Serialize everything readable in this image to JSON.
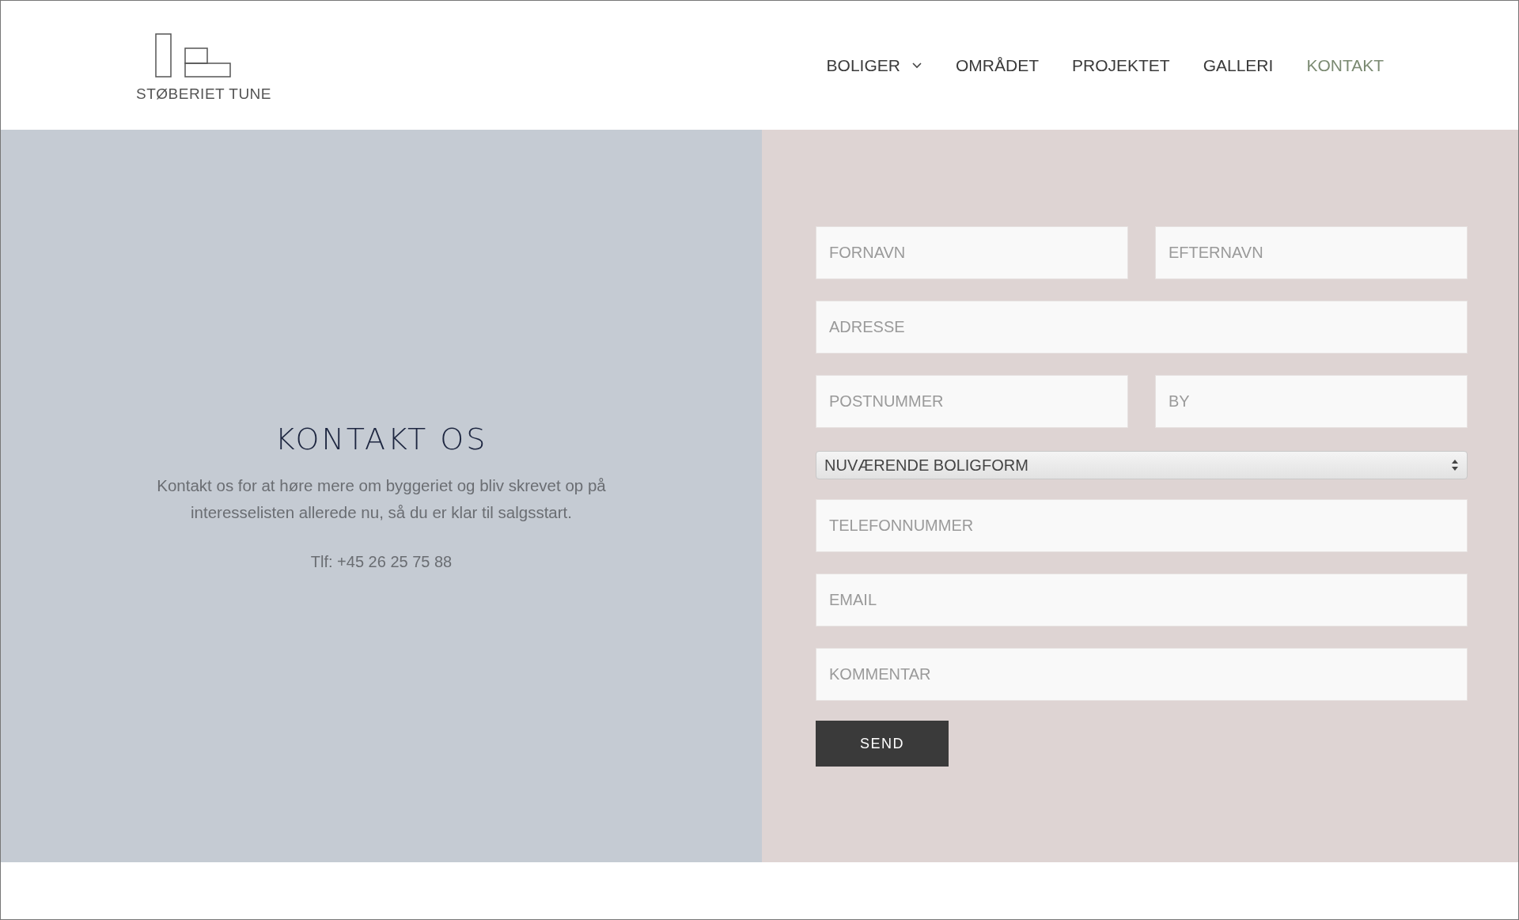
{
  "logo": {
    "text": "STØBERIET TUNE"
  },
  "nav": [
    {
      "label": "BOLIGER",
      "dropdown": true,
      "selected": false
    },
    {
      "label": "OMRÅDET",
      "dropdown": false,
      "selected": false
    },
    {
      "label": "PROJEKTET",
      "dropdown": false,
      "selected": false
    },
    {
      "label": "GALLERI",
      "dropdown": false,
      "selected": false
    },
    {
      "label": "KONTAKT",
      "dropdown": false,
      "selected": true
    }
  ],
  "contact": {
    "title": "KONTAKT OS",
    "text": "Kontakt os for at høre mere om byggeriet og bliv skrevet op på interesselisten allerede nu, så du er klar til salgsstart.",
    "phone": "Tlf: +45 26 25 75 88"
  },
  "form": {
    "rows": [
      [
        {
          "kind": "text",
          "placeholder": "FORNAVN"
        },
        {
          "kind": "text",
          "placeholder": "EFTERNAVN"
        }
      ],
      [
        {
          "kind": "text",
          "placeholder": "ADRESSE"
        }
      ],
      [
        {
          "kind": "text",
          "placeholder": "POSTNUMMER"
        },
        {
          "kind": "text",
          "placeholder": "BY"
        }
      ],
      [
        {
          "kind": "select",
          "value": "NUVÆRENDE BOLIGFORM"
        }
      ],
      [
        {
          "kind": "text",
          "placeholder": "TELEFONNUMMER"
        }
      ],
      [
        {
          "kind": "text",
          "placeholder": "EMAIL"
        }
      ],
      [
        {
          "kind": "text",
          "placeholder": "KOMMENTAR"
        }
      ]
    ],
    "submit": "SEND"
  }
}
